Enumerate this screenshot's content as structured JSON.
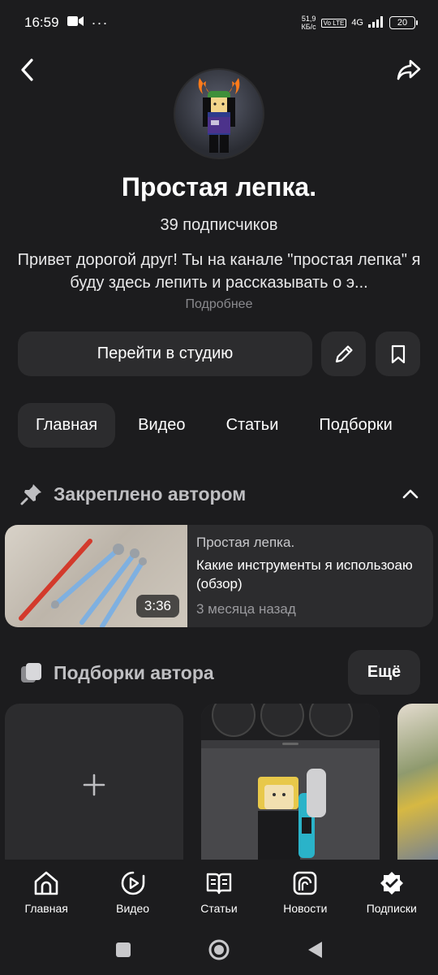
{
  "status_bar": {
    "time": "16:59",
    "network_speed_value": "51,9",
    "network_speed_unit": "КБ/с",
    "network_type": "4G",
    "volte_label": "Vo LTE",
    "battery": "20"
  },
  "channel": {
    "title": "Простая лепка.",
    "subscribers": "39 подписчиков",
    "description": "Привет дорогой друг! Ты на канале \"простая лепка\" я буду здесь лепить и рассказывать о э...",
    "more_link": "Подробнее"
  },
  "actions": {
    "studio_label": "Перейти в студию"
  },
  "tabs": [
    {
      "label": "Главная",
      "active": true
    },
    {
      "label": "Видео",
      "active": false
    },
    {
      "label": "Статьи",
      "active": false
    },
    {
      "label": "Подборки",
      "active": false
    }
  ],
  "pinned": {
    "header": "Закреплено автором",
    "video": {
      "channel": "Простая лепка.",
      "title": "Какие инструменты я использоаю (обзор)",
      "date": "3 месяца назад",
      "duration": "3:36"
    }
  },
  "collections": {
    "header": "Подборки автора",
    "more_label": "Ещё"
  },
  "bottom_nav": [
    {
      "label": "Главная",
      "icon": "home-icon"
    },
    {
      "label": "Видео",
      "icon": "video-icon"
    },
    {
      "label": "Статьи",
      "icon": "articles-icon"
    },
    {
      "label": "Новости",
      "icon": "news-icon"
    },
    {
      "label": "Подписки",
      "icon": "subscriptions-icon"
    }
  ],
  "colors": {
    "background": "#1c1c1e",
    "surface": "#2c2c2e",
    "text_primary": "#ffffff",
    "text_secondary": "#9a9a9e"
  }
}
